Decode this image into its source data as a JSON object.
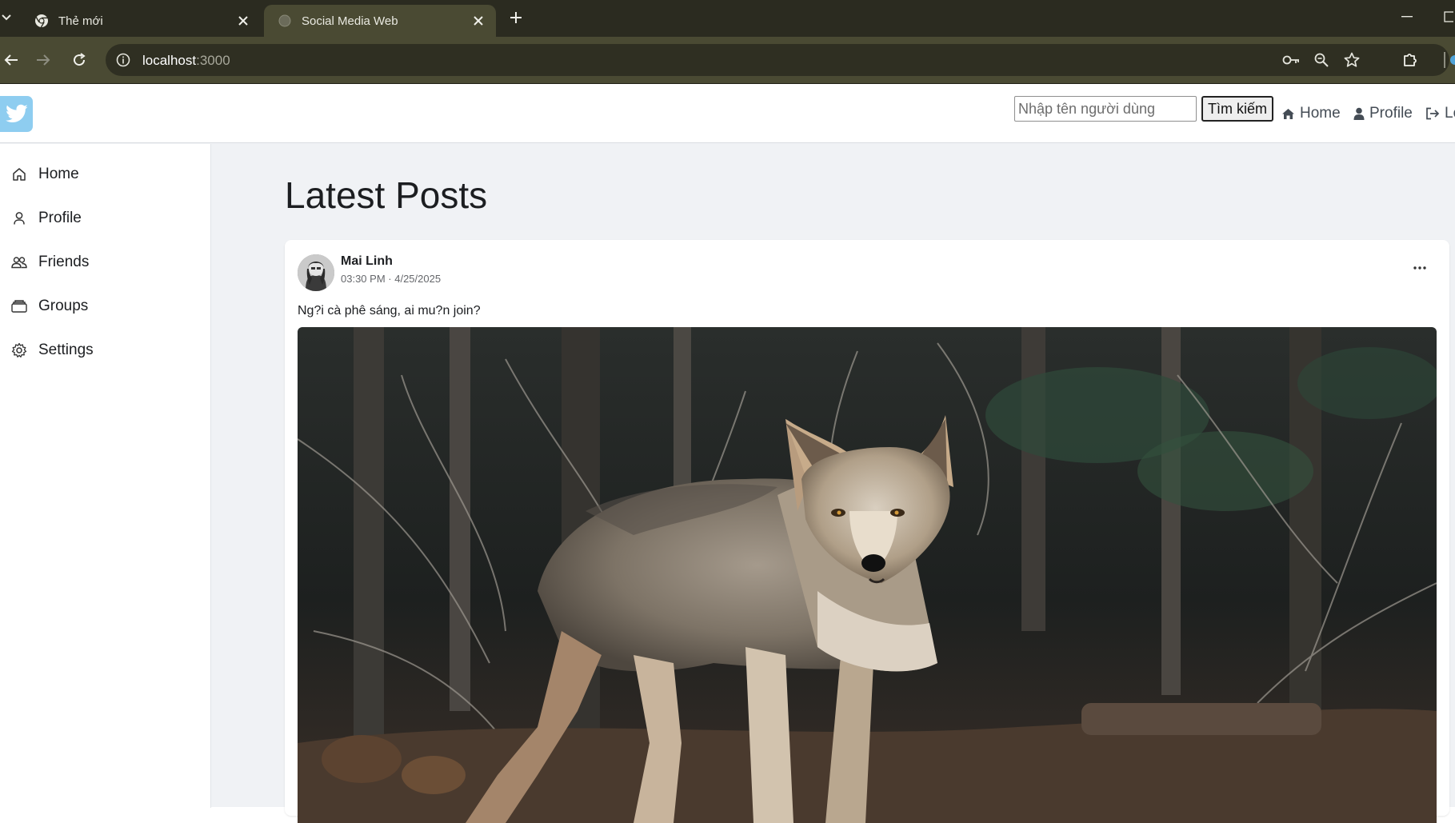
{
  "browser": {
    "tabs": [
      {
        "title": "Thẻ mới",
        "active": false
      },
      {
        "title": "Social Media Web",
        "active": true
      }
    ],
    "url_host": "localhost",
    "url_rest": ":3000"
  },
  "topbar": {
    "search_placeholder": "Nhập tên người dùng",
    "search_button": "Tìm kiếm",
    "links": {
      "home": "Home",
      "profile": "Profile",
      "logout": "Lo"
    }
  },
  "sidebar": {
    "items": [
      {
        "label": "Home",
        "icon": "home-icon"
      },
      {
        "label": "Profile",
        "icon": "user-icon"
      },
      {
        "label": "Friends",
        "icon": "friends-icon"
      },
      {
        "label": "Groups",
        "icon": "groups-icon"
      },
      {
        "label": "Settings",
        "icon": "gear-icon"
      }
    ]
  },
  "feed": {
    "title": "Latest Posts",
    "posts": [
      {
        "author": "Mai Linh",
        "time": "03:30 PM",
        "date": "4/25/2025",
        "text": "Ng?i cà phê sáng, ai mu?n join?",
        "image": "coyote-photo"
      }
    ]
  },
  "colors": {
    "chrome_tab_bg": "#2b2b20",
    "chrome_toolbar_bg": "#4a4a33",
    "logo_bg": "#8ecdf0",
    "page_bg": "#f0f2f5"
  }
}
